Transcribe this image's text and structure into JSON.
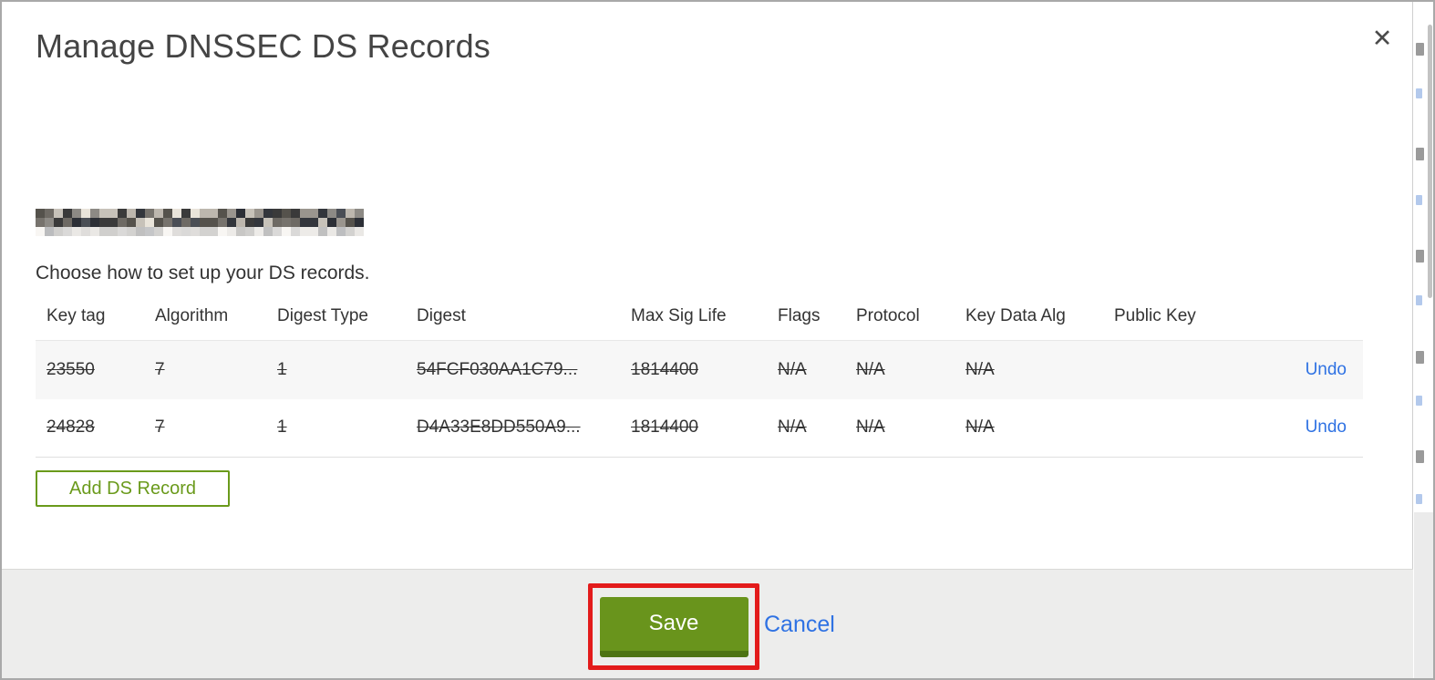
{
  "modal": {
    "title": "Manage DNSSEC DS Records",
    "close_label": "✕",
    "domain_redacted": true,
    "instruction": "Choose how to set up your DS records.",
    "table": {
      "headers": [
        "Key tag",
        "Algorithm",
        "Digest Type",
        "Digest",
        "Max Sig Life",
        "Flags",
        "Protocol",
        "Key Data Alg",
        "Public Key"
      ],
      "rows": [
        {
          "cells": [
            "23550",
            "7",
            "1",
            "54FCF030AA1C79...",
            "1814400",
            "N/A",
            "N/A",
            "N/A",
            ""
          ],
          "action": "Undo",
          "deleted": true
        },
        {
          "cells": [
            "24828",
            "7",
            "1",
            "D4A33E8DD550A9...",
            "1814400",
            "N/A",
            "N/A",
            "N/A",
            ""
          ],
          "action": "Undo",
          "deleted": true
        }
      ]
    },
    "add_button_label": "Add DS Record",
    "footer": {
      "save_label": "Save",
      "cancel_label": "Cancel"
    }
  },
  "annotation": {
    "shape": "rectangle",
    "target": "save-button",
    "color": "#e31b1b"
  },
  "redacted_block": {
    "cols": 36,
    "rows": 3,
    "palette": [
      "#3a3a3a",
      "#6e6a64",
      "#8d8a85",
      "#2c2f36",
      "#bdb7ae",
      "#55524c",
      "#77736d",
      "#e9e4da",
      "#4a4e55",
      "#9a958e",
      "#33363c",
      "#c7c2b9"
    ]
  },
  "colors": {
    "accent_green": "#69941c",
    "accent_green_dark": "#4d7313",
    "outline_green": "#6a9a1b",
    "link_blue": "#2f72e3",
    "annotation_red": "#e31b1b",
    "footer_bg": "#ededec",
    "row_alt_bg": "#f7f7f7",
    "title_color": "#444444"
  }
}
